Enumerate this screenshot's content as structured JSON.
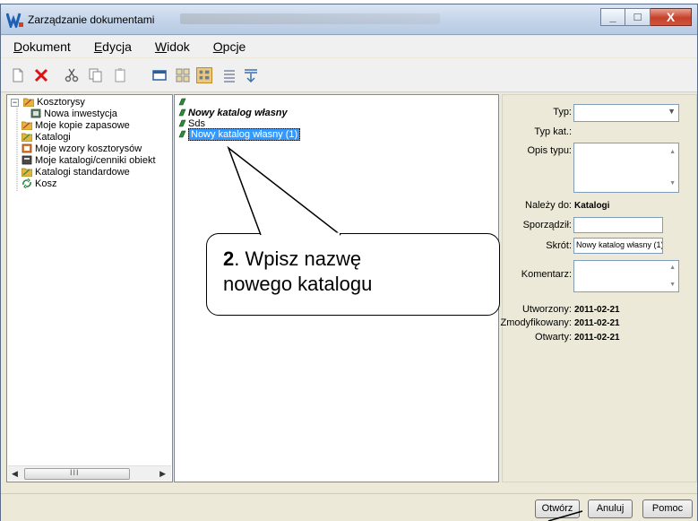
{
  "window": {
    "title": "Zarządzanie dokumentami"
  },
  "menu": [
    {
      "label": "Dokument",
      "key": "D",
      "rest": "okument"
    },
    {
      "label": "Edycja",
      "key": "E",
      "rest": "dycja"
    },
    {
      "label": "Widok",
      "key": "W",
      "rest": "idok"
    },
    {
      "label": "Opcje",
      "key": "O",
      "rest": "pcje"
    }
  ],
  "toolbar_icons": [
    "new-document-icon",
    "delete-icon",
    "cut-icon",
    "copy-icon",
    "paste-icon",
    "window-icon",
    "large-icons-view-icon",
    "details-view-icon",
    "list-view-icon",
    "filter-icon"
  ],
  "tree": [
    {
      "label": "Kosztorysy",
      "icon": "folder-icon"
    },
    {
      "label": "Nowa inwestycja",
      "icon": "document-icon"
    },
    {
      "label": "Moje kopie zapasowe",
      "icon": "folder-icon"
    },
    {
      "label": "Katalogi",
      "icon": "folder-icon"
    },
    {
      "label": "Moje wzory kosztorysów",
      "icon": "template-icon"
    },
    {
      "label": "Moje katalogi/cenniki obiekt",
      "icon": "book-icon"
    },
    {
      "label": "Katalogi standardowe",
      "icon": "folder-icon"
    },
    {
      "label": "Kosz",
      "icon": "recycle-icon"
    }
  ],
  "list": [
    {
      "label": ""
    },
    {
      "label": "Nowy katalog własny"
    },
    {
      "label": "Sds"
    },
    {
      "label": "Nowy katalog własny (1)"
    }
  ],
  "props": {
    "typ_label": "Typ:",
    "typkat_label": "Typ kat.:",
    "opis_label": "Opis typu:",
    "nalezy_label": "Należy do:",
    "nalezy_value": "Katalogi",
    "sporzadzil_label": "Sporządził:",
    "skrot_label": "Skrót:",
    "skrot_value": "Nowy katalog własny (1)",
    "komentarz_label": "Komentarz:",
    "utworzony_label": "Utworzony:",
    "utworzony_value": "2011-02-21",
    "modyfikowany_label": "Zmodyfikowany:",
    "modyfikowany_value": "2011-02-21",
    "otwarty_label": "Otwarty:",
    "otwarty_value": "2011-02-21"
  },
  "buttons": {
    "otworz": "Otwórz",
    "anuluj": "Anuluj",
    "pomoc": "Pomoc"
  },
  "callout": {
    "number": "2",
    "line1": ". Wpisz nazwę",
    "line2": "nowego katalogu"
  },
  "scroll_thumb_glyph": "III"
}
